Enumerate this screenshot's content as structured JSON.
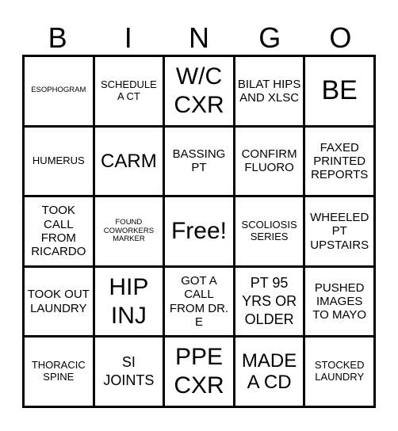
{
  "header": {
    "letters": [
      "B",
      "I",
      "N",
      "G",
      "O"
    ]
  },
  "cells": [
    [
      "ESOPHOGRAM",
      "SCHEDULE A CT",
      "W/C CXR",
      "BILAT HIPS AND XLSC",
      "BE"
    ],
    [
      "HUMERUS",
      "CARM",
      "BASSING PT",
      "CONFIRM FLUORO",
      "FAXED PRINTED REPORTS"
    ],
    [
      "TOOK CALL FROM RICARDO",
      "FOUND COWORKERS MARKER",
      "Free!",
      "SCOLIOSIS SERIES",
      "WHEELED PT UPSTAIRS"
    ],
    [
      "TOOK OUT LAUNDRY",
      "HIP INJ",
      "GOT A CALL FROM DR. E",
      "PT 95 YRS OR OLDER",
      "PUSHED IMAGES TO MAYO"
    ],
    [
      "THORACIC SPINE",
      "SI JOINTS",
      "PPE CXR",
      "MADE A CD",
      "STOCKED LAUNDRY"
    ]
  ]
}
